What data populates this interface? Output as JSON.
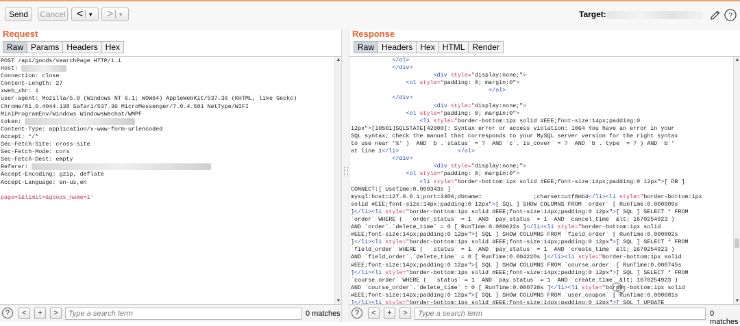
{
  "toolbar": {
    "send_label": "Send",
    "cancel_label": "Cancel",
    "target_label": "Target:"
  },
  "request": {
    "title": "Request",
    "tabs": [
      "Raw",
      "Params",
      "Headers",
      "Hex"
    ],
    "active_tab": "Raw",
    "lines": [
      "POST /api/goods/searchPage HTTP/1.1",
      "Host: ",
      "Connection: close",
      "Content-Length: 27",
      "xweb_xhr: 1",
      "user-agent: Mozilla/5.0 (Windows NT 6.1; WOW64) AppleWebKit/537.36 (KHTML, like Gecko)",
      "Chrome/81.0.4044.138 Safari/537.36 MicroMessenger/7.0.4.501 NetType/WIFI",
      "MiniProgramEnv/Windows WindowsWechat/WMPF",
      "token: ",
      "Content-Type: application/x-www-form-urlencoded",
      "Accept: */*",
      "Sec-Fetch-Site: cross-site",
      "Sec-Fetch-Mode: cors",
      "Sec-Fetch-Dest: empty",
      "Referer: ",
      "Accept-Encoding: gzip, deflate",
      "Accept-Language: en-us,en",
      "",
      "page=1&limit=&goods_name=1'"
    ],
    "search_placeholder": "Type a search term",
    "matches": "0 matches"
  },
  "response": {
    "title": "Response",
    "tabs": [
      "Raw",
      "Headers",
      "Hex",
      "HTML",
      "Render"
    ],
    "active_tab": "Raw",
    "lines": [
      "            </ol>",
      "            </div>",
      "                        <div style=\"display:none;\">",
      "                <ol style=\"padding: 0; margin:0\">",
      "                                        </ol>",
      "            </div>",
      "                        <div style=\"display:none;\">",
      "                <ol style=\"padding: 0; margin:0\">",
      "                    <li style=\"border-bottom:1px solid #EEE;font-size:14px;padding:0",
      "12px\">[10501]SQLSTATE[42000]: Syntax error or access violation: 1064 You have an error in your",
      "SQL syntax; check the manual that corresponds to your MySQL server version for the right syntax",
      "to use near '%' )  AND `b`.`status` = ?  AND `c`.`is_cover` = ?  AND `b`.`type` = ? ) AND `b`'",
      "at line 1</li>                 </ol>",
      "            </div>",
      "                        <div style=\"display:none;\">",
      "                <ol style=\"padding: 0; margin:0\">",
      "                    <li style=\"border-bottom:1px solid #EEE;font-size:14px;padding:0 12px\">[ DB ]",
      "CONNECT:[ UseTime:0.000343s ]",
      "mysql:host=127.0.0.1;port=3306;dbname=               ;charset=utf8mb4</li><li style=\"border-bottom:1px",
      "solid #EEE;font-size:14px;padding:0 12px\">[ SQL ] SHOW COLUMNS FROM `order` [ RunTime:0.000909s",
      "]</li><li style=\"border-bottom:1px solid #EEE;font-size:14px;padding:0 12px\">[ SQL ] SELECT * FROM",
      "`order` WHERE (  `order_status` = 1  AND `pay_status` = 1  AND `cancel_time` &lt; 1670254923 )",
      "AND `order`.`delete_time` = 0 [ RunTime:0.000622s ]</li><li style=\"border-bottom:1px solid",
      "#EEE;font-size:14px;padding:0 12px\">[ SQL ] SHOW COLUMNS FROM `field_order` [ RunTime:0.000802s",
      "]</li><li style=\"border-bottom:1px solid #EEE;font-size:14px;padding:0 12px\">[ SQL ] SELECT * FROM",
      "`field_order` WHERE (  `status` = 1  AND `pay_status` = 1  AND `create_time` &lt; 1670254923 )",
      "AND `field_order`.`delete_time` = 0 [ RunTime:0.004220s ]</li><li style=\"border-bottom:1px solid",
      "#EEE;font-size:14px;padding:0 12px\">[ SQL ] SHOW COLUMNS FROM `course_order` [ RunTime:0.000745s",
      "]</li><li style=\"border-bottom:1px solid #EEE;font-size:14px;padding:0 12px\">[ SQL ] SELECT * FROM",
      "`course_order` WHERE (  `status` = 1  AND `pay_status` = 1  AND `create_time` &lt; 1670254923 )",
      "AND `course_order`.`delete_time` = 0 [ RunTime:0.000728s ]</li><li style=\"border-bottom:1px solid",
      "#EEE;font-size:14px;padding:0 12px\">[ SQL ] SHOW COLUMNS FROM `user_coupon` [ RunTime:0.000681s",
      "]</li><li style=\"border-bottom:1px solid #EEE;font-size:14px;padding:0 12px\">[ SQL ] UPDATE"
    ],
    "search_placeholder": "Type a search term",
    "matches": "0 matches"
  },
  "colors": {
    "section_title": "#e8602c",
    "tag": "#1f3fb8",
    "attribute": "#c8346a"
  }
}
